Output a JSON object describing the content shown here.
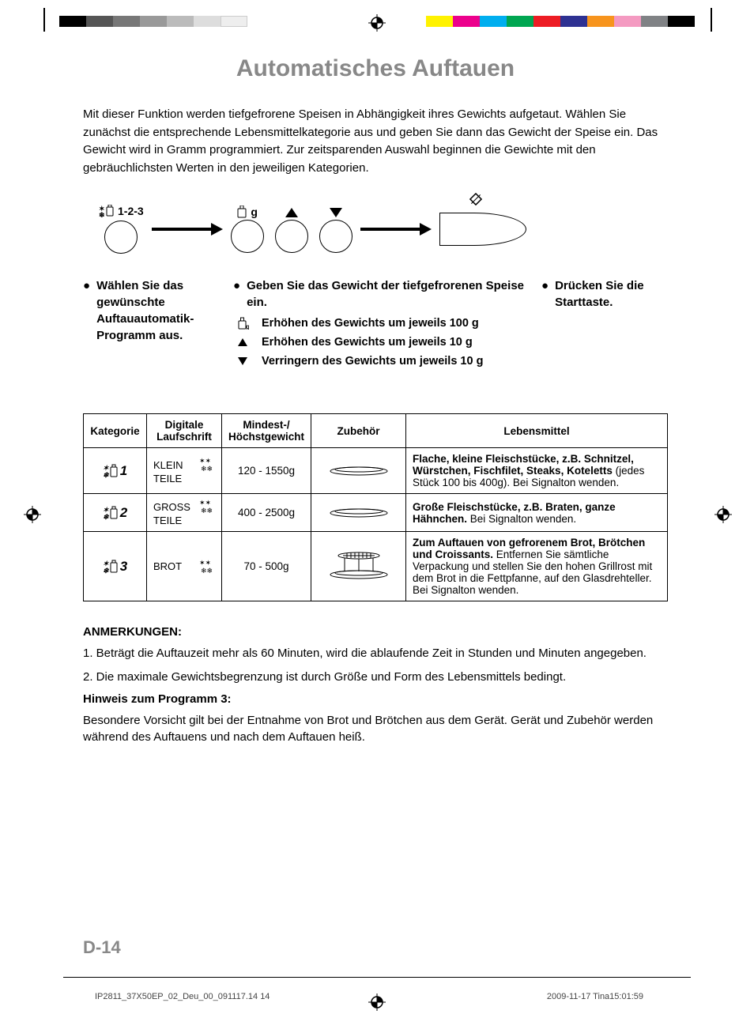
{
  "title": "Automatisches Auftauen",
  "intro": "Mit dieser Funktion werden tiefgefrorene Speisen in Abhängigkeit ihres Gewichts aufgetaut. Wählen Sie zunächst die entsprechende Lebensmittelkategorie aus und geben Sie dann das Gewicht der Speise ein. Das Gewicht wird in Gramm programmiert. Zur zeitsparenden Auswahl beginnen die Gewichte mit den gebräuchlichsten Werten in den jeweiligen Kategorien.",
  "diagram": {
    "label123": "1-2-3",
    "g_label": "g"
  },
  "steps": {
    "s1": "Wählen Sie das gewün­schte Auftauautomatik-Programm aus.",
    "s2_head": "Geben Sie das Gewicht der tiefgefrorenen Speise ein.",
    "s2_lines": [
      "Erhöhen des Gewichts um jeweils 100 g",
      "Erhöhen des Gewichts um jeweils 10 g",
      "Verringern des Gewichts um jeweils 10 g"
    ],
    "s3": "Drücken Sie die Starttaste."
  },
  "table": {
    "headers": [
      "Kategorie",
      "Digitale Laufschrift",
      "Mindest-/ Höchstgewicht",
      "Zubehör",
      "Lebensmittel"
    ],
    "rows": [
      {
        "cat_num": "1",
        "scroll_top": "KLEIN",
        "scroll_bot": "TEILE",
        "weight": "120 - 1550g",
        "food_bold": "Flache, kleine Fleischstücke, z.B. Schnitzel, Würstchen, Fischfilet, Steaks, Koteletts",
        "food_rest": " (jedes Stück 100 bis 400g). Bei Signalton wenden."
      },
      {
        "cat_num": "2",
        "scroll_top": "GROSS",
        "scroll_bot": "TEILE",
        "weight": "400 - 2500g",
        "food_bold": "Große Fleischstücke, z.B. Braten, ganze Hähnchen.",
        "food_rest": " Bei Signalton wenden."
      },
      {
        "cat_num": "3",
        "scroll_top": "BROT",
        "scroll_bot": "",
        "weight": "70 - 500g",
        "food_bold": "Zum Auftauen von gefrorenem Brot, Brötchen und Croissants.",
        "food_rest": " Entfernen Sie sämtliche Verpackung und stellen Sie den hohen Grillrost mit dem Brot in die Fettpfanne, auf den Glasdrehteller. Bei Signalton wenden."
      }
    ]
  },
  "notes": {
    "heading": "ANMERKUNGEN:",
    "n1": "1. Beträgt die Auftauzeit mehr als 60 Minuten, wird die ablaufende Zeit in Stunden und Minuten angegeben.",
    "n2": "2. Die maximale Gewichtsbegrenzung ist durch Größe und Form des Lebensmittels bedingt.",
    "hint_head": "Hinweis zum Programm 3:",
    "hint": "Besondere Vorsicht gilt bei der Entnahme von Brot und Brötchen aus dem Gerät. Gerät und Zubehör werden während des Auftauens und nach dem Auftauen heiß."
  },
  "page_number": "D-14",
  "footer_left": "IP2811_37X50EP_02_Deu_00_091117.14    14",
  "footer_right": "2009-11-17   Tina15:01:59",
  "colors": [
    "#fff200",
    "#ec008c",
    "#00aeef",
    "#00a651",
    "#ed1c24",
    "#2e3192",
    "#f7941d",
    "#f49ac1",
    "#808285",
    "#000000"
  ]
}
